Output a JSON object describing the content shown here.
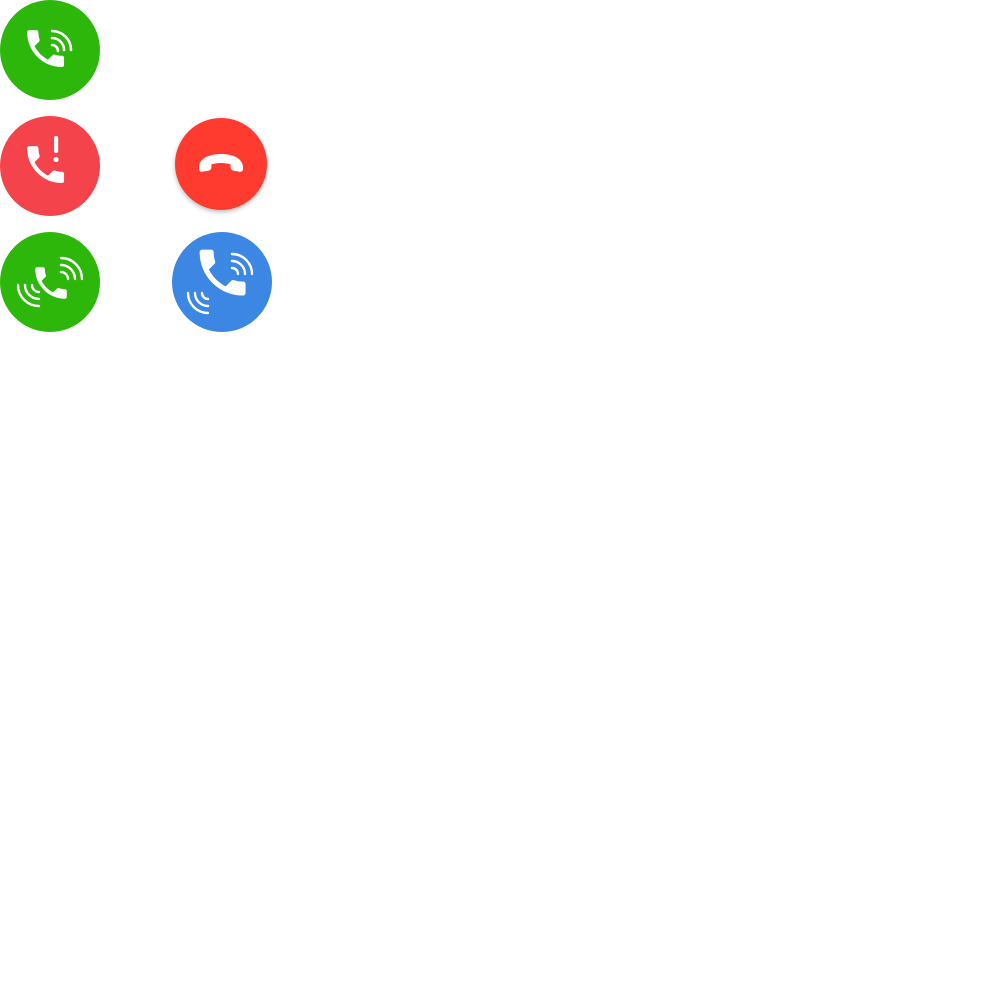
{
  "buttons": {
    "incoming_call": {
      "icon": "phone-ringing-icon",
      "color": "#2DB70B"
    },
    "missed_call": {
      "icon": "phone-alert-icon",
      "color": "#F5434B"
    },
    "hang_up": {
      "icon": "phone-hangup-icon",
      "color": "#FF3B30"
    },
    "ringing_call": {
      "icon": "phone-vibrating-icon",
      "color": "#2DB70B"
    },
    "voice_call": {
      "icon": "phone-vibrating-icon",
      "color": "#3C86E4"
    }
  }
}
